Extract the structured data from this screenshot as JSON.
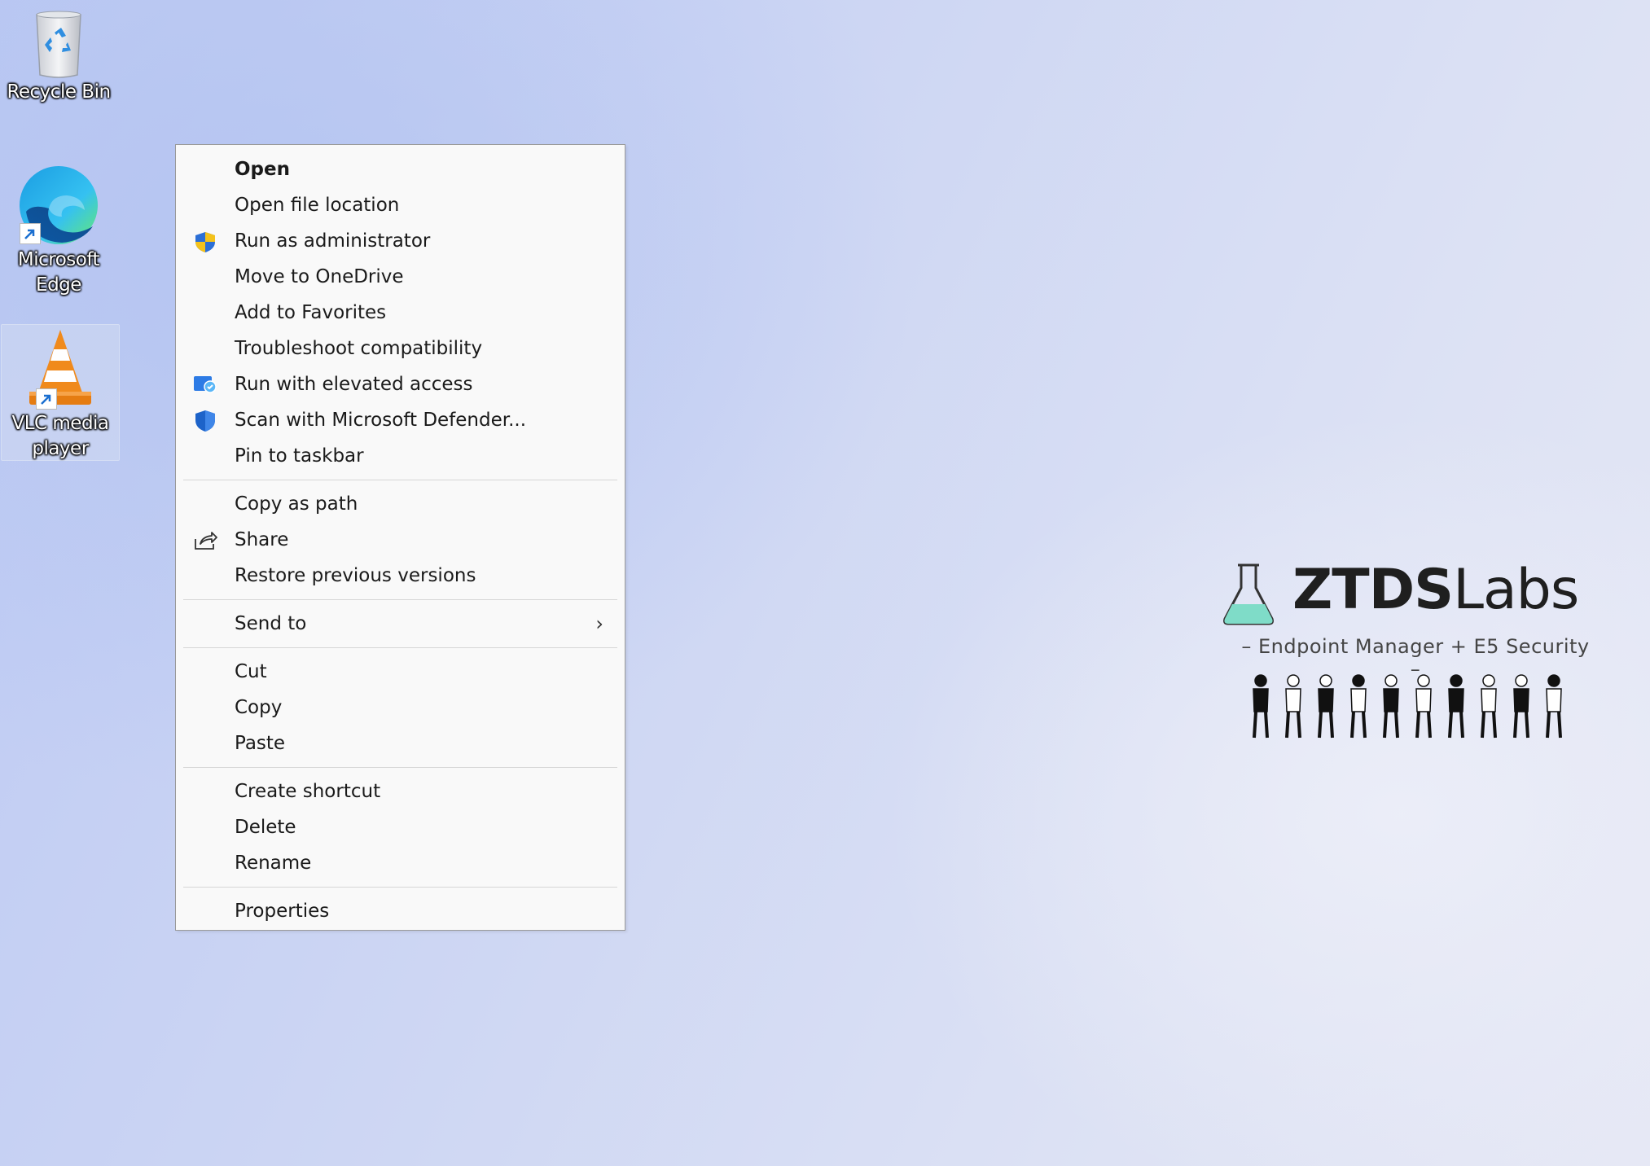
{
  "desktop": {
    "icons": [
      {
        "label": "Recycle Bin"
      },
      {
        "label": "Microsoft Edge"
      },
      {
        "label": "VLC media player"
      }
    ]
  },
  "context_menu": {
    "groups": [
      [
        {
          "label": "Open",
          "bold": true,
          "icon": null
        },
        {
          "label": "Open file location",
          "icon": null
        },
        {
          "label": "Run as administrator",
          "icon": "uac-shield-icon"
        },
        {
          "label": "Move to OneDrive",
          "icon": null
        },
        {
          "label": "Add to Favorites",
          "icon": null
        },
        {
          "label": "Troubleshoot compatibility",
          "icon": null
        },
        {
          "label": "Run with elevated access",
          "icon": "elevated-access-icon"
        },
        {
          "label": "Scan with Microsoft Defender...",
          "icon": "defender-shield-icon"
        },
        {
          "label": "Pin to taskbar",
          "icon": null
        }
      ],
      [
        {
          "label": "Copy as path",
          "icon": null
        },
        {
          "label": "Share",
          "icon": "share-icon"
        },
        {
          "label": "Restore previous versions",
          "icon": null
        }
      ],
      [
        {
          "label": "Send to",
          "icon": null,
          "submenu": true,
          "submenu_glyph": "›"
        }
      ],
      [
        {
          "label": "Cut",
          "icon": null
        },
        {
          "label": "Copy",
          "icon": null
        },
        {
          "label": "Paste",
          "icon": null
        }
      ],
      [
        {
          "label": "Create shortcut",
          "icon": null
        },
        {
          "label": "Delete",
          "icon": null
        },
        {
          "label": "Rename",
          "icon": null
        }
      ],
      [
        {
          "label": "Properties",
          "icon": null
        }
      ]
    ]
  },
  "wallpaper_logo": {
    "title_bold": "ZTDS",
    "title_light": "Labs",
    "subtitle": "– Endpoint Manager + E5 Security –",
    "icon": "flask-icon"
  },
  "colors": {
    "menu_bg": "#f9f9f9",
    "menu_border": "#9a9a9a",
    "separator": "#d6d6d6",
    "flask": "#7fdcc8"
  }
}
